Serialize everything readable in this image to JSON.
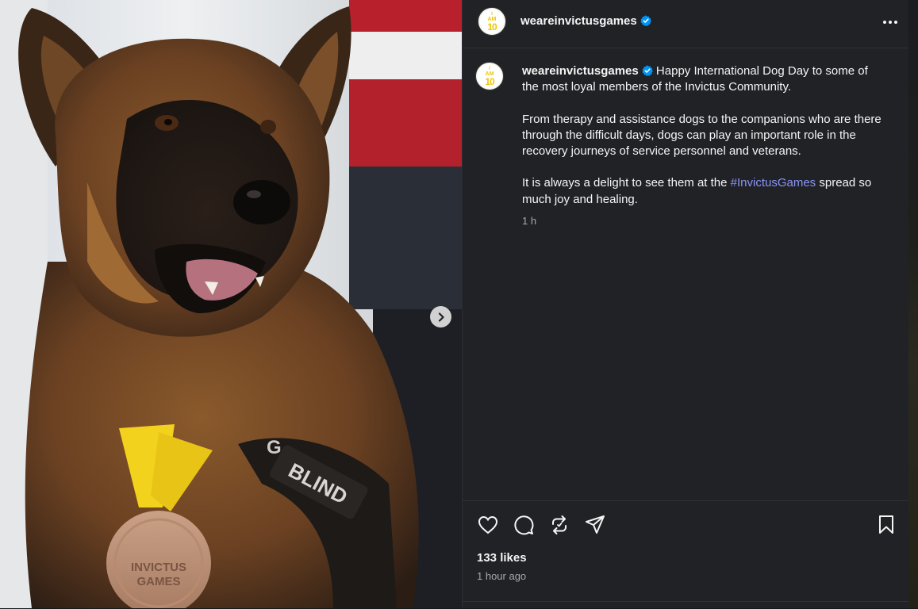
{
  "post": {
    "username": "weareinvictusgames",
    "avatar_text": [
      "I",
      "AM",
      "10"
    ],
    "caption_paragraphs": [
      "Happy International Dog Day to some of the most loyal members of the Invictus Community.",
      "From therapy and assistance dogs to the companions who are there through the difficult days, dogs can play an important role in the recovery journeys of service personnel and veterans."
    ],
    "caption_last_before": "It is always a delight to see them at the ",
    "caption_hashtag": "#InvictusGames",
    "caption_last_after": " spread so much joy and healing.",
    "caption_time": "1 h",
    "likes": "133 likes",
    "posted_ago": "1 hour ago"
  },
  "photo": {
    "medal_text": [
      "INVICTUS",
      "GAMES"
    ],
    "harness_text": "BLIND",
    "harness_text_left": "G"
  },
  "icons": {
    "verified": "verified-badge-icon",
    "more": "more-options-icon",
    "next": "chevron-right-icon",
    "like": "heart-icon",
    "comment": "comment-bubble-icon",
    "repost": "repost-icon",
    "share": "send-icon",
    "save": "bookmark-icon"
  },
  "colors": {
    "panel_bg": "#212226",
    "hashtag": "#8a94f5",
    "verified_blue": "#0095f6",
    "avatar_yellow": "#f1c500"
  }
}
